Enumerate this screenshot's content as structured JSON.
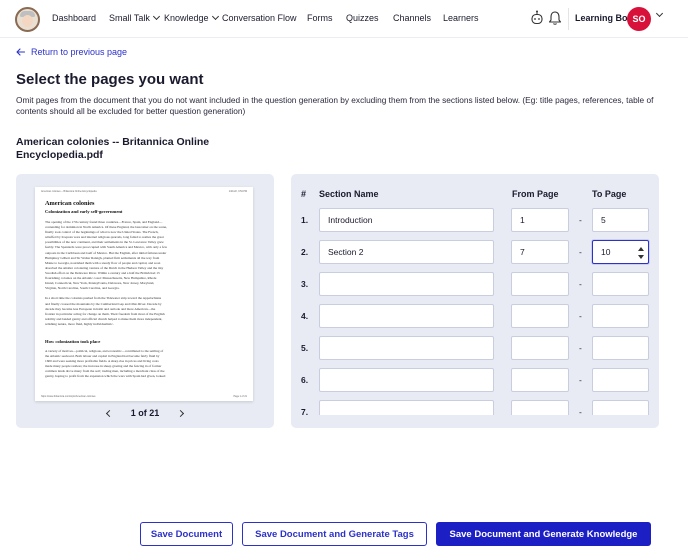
{
  "nav": {
    "items": [
      {
        "label": "Dashboard",
        "has_dropdown": false
      },
      {
        "label": "Small Talk",
        "has_dropdown": true
      },
      {
        "label": "Knowledge",
        "has_dropdown": true
      },
      {
        "label": "Conversation Flow",
        "has_dropdown": false
      },
      {
        "label": "Forms",
        "has_dropdown": false
      },
      {
        "label": "Quizzes",
        "has_dropdown": false
      },
      {
        "label": "Channels",
        "has_dropdown": false
      },
      {
        "label": "Learners",
        "has_dropdown": false
      }
    ],
    "icons": [
      "bot-icon",
      "bell-icon"
    ],
    "user_name": "Learning Bot",
    "avatar_initials": "SO",
    "avatar_color": "#d7113a"
  },
  "back_link": "Return to previous page",
  "page_title": "Select the pages you want",
  "instructions": "Omit pages from the document that you do not want included in the question generation by excluding them from the sections listed below. (Eg: title pages, references, table of contents should all be excluded for better question generation)",
  "document_name": "American colonies -- Britannica Online Encyclopedia.pdf",
  "preview": {
    "header_left": "American colonies -- Britannica Online Encyclopedia",
    "header_right": "1/21/22, 3:54 PM",
    "heading": "American colonies",
    "subheading": "Colonization and early self-government",
    "body": "The opening of the 17th century found three countries—France, Spain, and England—\ncontending for dominion in North America. Of these England, the latecomer on the scene,\nfinally took control of the beginnings of what is now the United States. The French,\nrebuffed by Iroquois wars and internal religious quarrels, long failed to realize the great\npossibilities of the new continent, and their settlements in the St. Lawrence Valley grew\nfeebly. The Spaniards were preoccupied with South America and Mexico, with only a few\noutposts in the Caribbean and Gulf of Mexico. But the English, after initial failures under\nHumphrey Gilbert and Sir Walter Raleigh, planted firm settlements all the way from\nMaine to Georgia, nourished them with a steady flow of people and capital, and soon\nabsorbed the smaller colonizing venture of the Dutch in the Hudson Valley and the tiny\nSwedish effort on the Delaware River. Within a century and a half the British had 13\nflourishing colonies on the Atlantic coast: Massachusetts, New Hampshire, Rhode\nIsland, Connecticut, New York, Pennsylvania, Delaware, New Jersey, Maryland,\nVirginia, North Carolina, South Carolina, and Georgia.\n\nIn a short time the colonists pushed from the Tidewater strip toward the Appalachians\nand finally crossed the mountains by the Cumberland Gap and Ohio River. Decade by\ndecade they became less European in habit and outlook and more American—the\nfrontier in particular acting for change on them. Their freedom from most of the English\nnobility and landed gentry and official church helped to make them more independent,\nrelishing nature, more fluid, highly individualistic.",
    "subheading2": "How colonization took place",
    "body2": "A variety of motives—political, religious, and economic—contributed to the settling of\nthe Atlantic seaboard. Both labour and capital in England had become fairly fluid by\n1600 and were seeking more profitable fields. A sharp rise in prices and living costs\nmade many people restless; the increase in sheep grazing and the fencing in of former\ncommon lands drove many from the soil; trading men, including a merchant class of the\ngentry, hoping to profit from the expansion which the wars with Spain had given, looked",
    "footer_left": "https://www.britannica.com/topic/American-colonies",
    "footer_right": "Page 1 of 21",
    "pager_text": "1 of 21"
  },
  "table": {
    "headers": {
      "num": "#",
      "name": "Section Name",
      "from": "From Page",
      "to": "To Page"
    },
    "rows": [
      {
        "num": "1.",
        "name": "Introduction",
        "from": "1",
        "to": "5"
      },
      {
        "num": "2.",
        "name": "Section 2",
        "from": "7",
        "to": "10"
      },
      {
        "num": "3.",
        "name": "",
        "from": "",
        "to": ""
      },
      {
        "num": "4.",
        "name": "",
        "from": "",
        "to": ""
      },
      {
        "num": "5.",
        "name": "",
        "from": "",
        "to": ""
      },
      {
        "num": "6.",
        "name": "",
        "from": "",
        "to": ""
      },
      {
        "num": "7.",
        "name": "",
        "from": "",
        "to": ""
      }
    ],
    "dash": "-"
  },
  "buttons": {
    "save_document": "Save Document",
    "save_generate_tags": "Save Document and Generate Tags",
    "save_generate_knowledge": "Save Document and Generate Knowledge"
  },
  "colors": {
    "accent": "#2c31c9",
    "primary_button": "#1b1fc4",
    "panel_bg": "#e8ebf4"
  }
}
